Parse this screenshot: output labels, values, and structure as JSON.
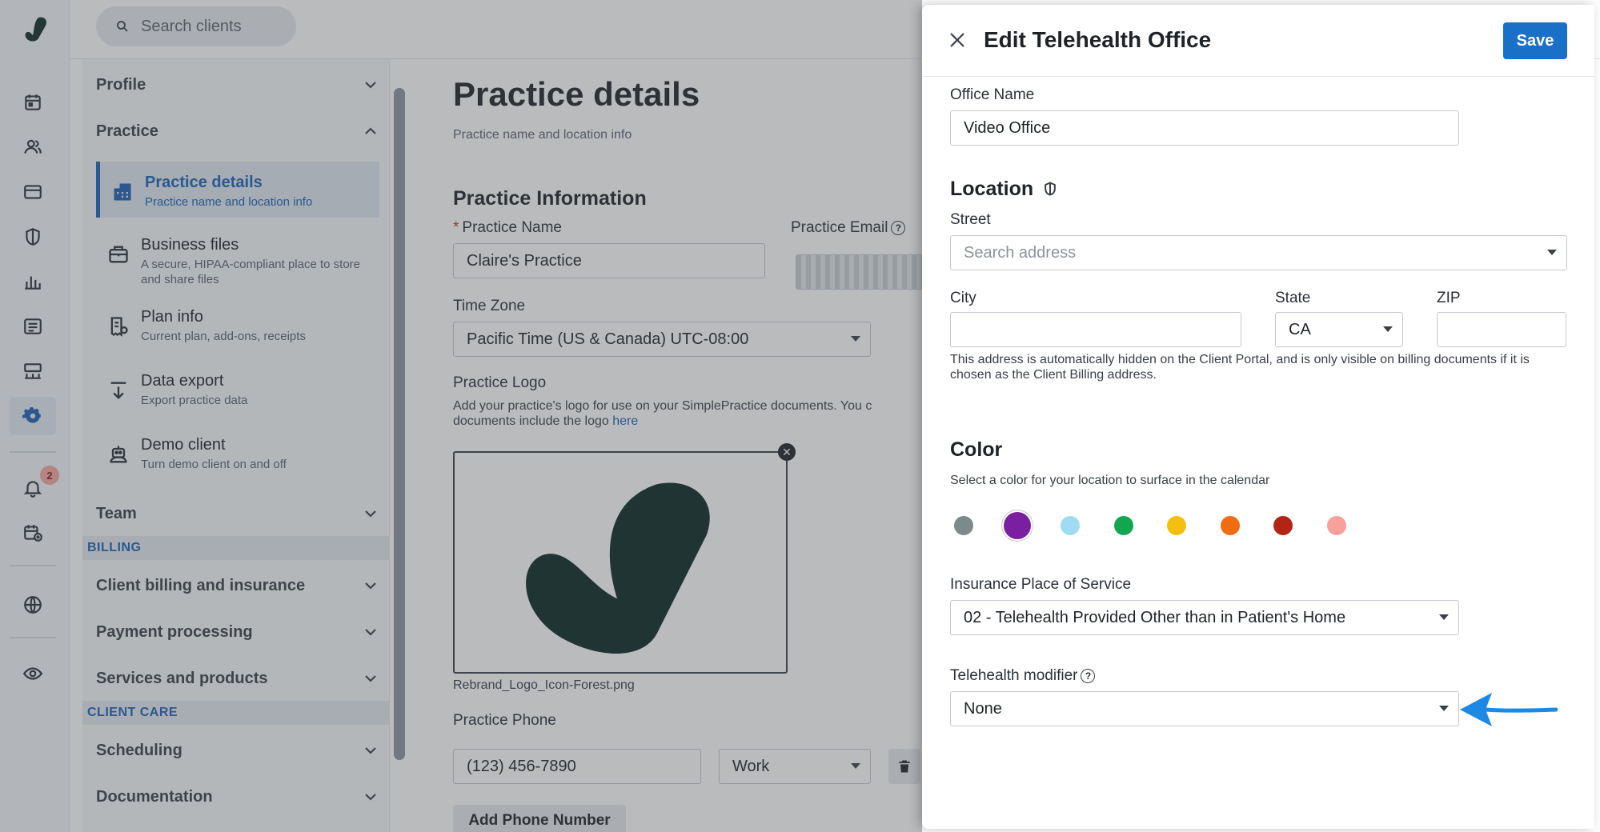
{
  "search": {
    "placeholder": "Search clients"
  },
  "rail": {
    "icons": [
      "logo-icon",
      "calendar-icon",
      "clients-icon",
      "billing-card-icon",
      "shield-icon",
      "analytics-icon",
      "list-icon",
      "marketing-icon",
      "settings-gear-icon",
      "bell-icon",
      "calendar-add-icon",
      "globe-icon",
      "eye-icon"
    ],
    "notification_count": "2"
  },
  "settings_nav": {
    "profile": "Profile",
    "practice": "Practice",
    "items": [
      {
        "title": "Practice details",
        "desc": "Practice name and location info"
      },
      {
        "title": "Business files",
        "desc": "A secure, HIPAA-compliant place to store and share files"
      },
      {
        "title": "Plan info",
        "desc": "Current plan, add-ons, receipts"
      },
      {
        "title": "Data export",
        "desc": "Export practice data"
      },
      {
        "title": "Demo client",
        "desc": "Turn demo client on and off"
      }
    ],
    "team": "Team",
    "billing_cat": "BILLING",
    "billing_items": [
      "Client billing and insurance",
      "Payment processing",
      "Services and products"
    ],
    "clientcare_cat": "CLIENT CARE",
    "clientcare_items": [
      "Scheduling",
      "Documentation"
    ]
  },
  "main": {
    "title": "Practice details",
    "subtitle": "Practice name and location info",
    "section": "Practice Information",
    "practice_name_label": "Practice Name",
    "practice_name_value": "Claire's Practice",
    "practice_email_label": "Practice Email",
    "timezone_label": "Time Zone",
    "timezone_value": "Pacific Time (US & Canada) UTC-08:00",
    "logo_label": "Practice Logo",
    "logo_desc_1": "Add your practice's logo for use on your SimplePractice documents. You c",
    "logo_desc_2": "documents include the logo ",
    "logo_desc_link": "here",
    "logo_filename": "Rebrand_Logo_Icon-Forest.png",
    "phone_label": "Practice Phone",
    "phone_value": "(123) 456-7890",
    "phone_type": "Work",
    "add_phone": "Add Phone Number"
  },
  "drawer": {
    "title": "Edit Telehealth Office",
    "save": "Save",
    "office_name_label": "Office Name",
    "office_name_value": "Video Office",
    "location_heading": "Location",
    "street_label": "Street",
    "street_placeholder": "Search address",
    "city_label": "City",
    "state_label": "State",
    "state_value": "CA",
    "zip_label": "ZIP",
    "address_note": "This address is automatically hidden on the Client Portal, and is only visible on billing documents if it is chosen as the Client Billing address.",
    "color_heading": "Color",
    "color_desc": "Select a color for your location to surface in the calendar",
    "colors": [
      "#7c8b8a",
      "#7b1fa2",
      "#9fdcf2",
      "#13a650",
      "#f5bf10",
      "#ef6c12",
      "#b32415",
      "#f7a09c"
    ],
    "selected_color": "#7b1fa2",
    "pos_label": "Insurance Place of Service",
    "pos_value": "02 - Telehealth Provided Other than in Patient's Home",
    "modifier_label": "Telehealth modifier",
    "modifier_value": "None"
  }
}
